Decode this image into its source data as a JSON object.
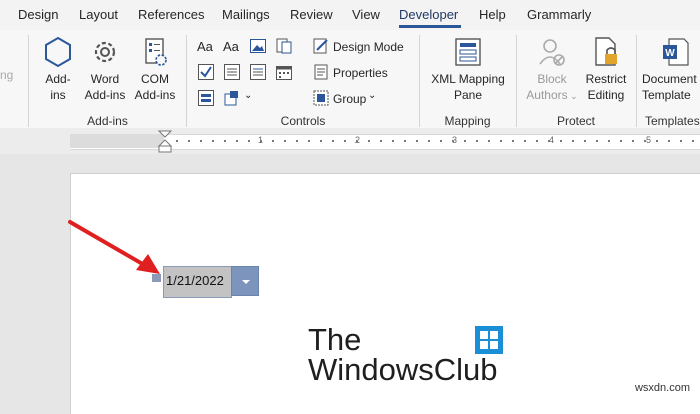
{
  "tabs": [
    "Design",
    "Layout",
    "References",
    "Mailings",
    "Review",
    "View",
    "Developer",
    "Help",
    "Grammarly"
  ],
  "active_tab": "Developer",
  "ribbon": {
    "addins": {
      "add_ins": "Add-\nins",
      "word_addins": "Word\nAdd-ins",
      "com_addins": "COM\nAdd-ins",
      "group": "Add-ins"
    },
    "controls": {
      "aa1": "Aa",
      "aa2": "Aa",
      "design_mode": "Design Mode",
      "properties": "Properties",
      "group_btn": "Group",
      "group": "Controls"
    },
    "mapping": {
      "xml_mapping_pane": "XML Mapping\nPane",
      "group": "Mapping"
    },
    "protect": {
      "block_authors": "Block\nAuthors",
      "restrict_editing": "Restrict\nEditing",
      "group": "Protect"
    },
    "templates": {
      "document_template": "Document\nTemplate",
      "group": "Templates"
    }
  },
  "ruler": {
    "numbers": [
      "1",
      "2",
      "3",
      "4",
      "5"
    ]
  },
  "document": {
    "date_value": "1/21/2022",
    "logo_line1": "The",
    "logo_line2": "WindowsClub"
  },
  "watermark": "wsxdn.com",
  "colors": {
    "accent": "#2b579a",
    "arrow": "#e02020",
    "control": "#7d95bd"
  }
}
